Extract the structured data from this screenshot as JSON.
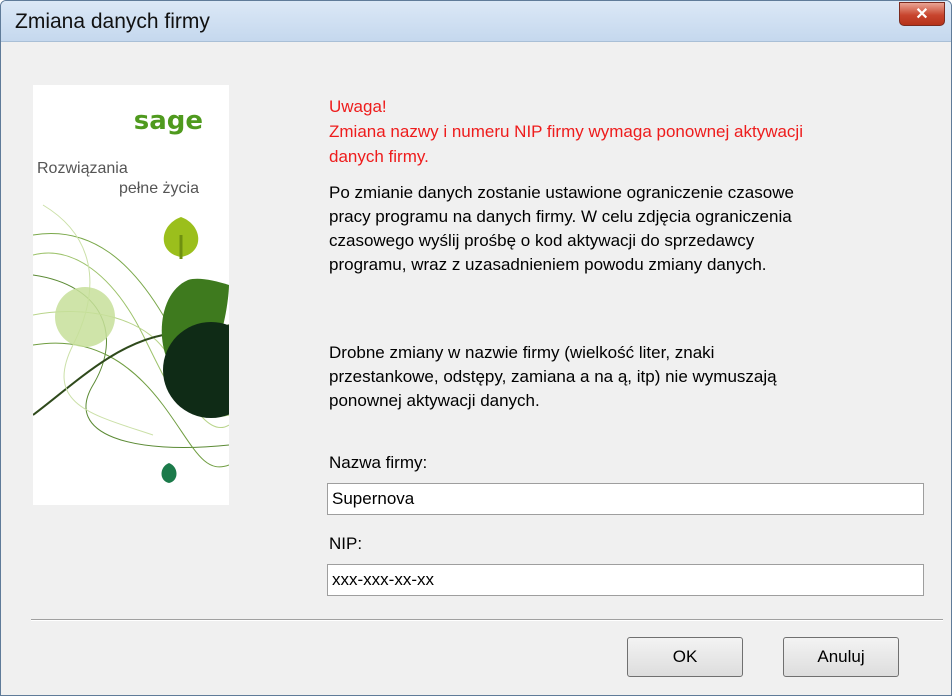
{
  "window": {
    "title": "Zmiana danych firmy",
    "close_label": "✕"
  },
  "banner": {
    "brand": "sage",
    "tagline_line1": "Rozwiązania",
    "tagline_line2": "pełne życia"
  },
  "warning": {
    "line1": "Uwaga!",
    "line2": "Zmiana nazwy i numeru NIP firmy wymaga ponownej aktywacji",
    "line3": "danych firmy."
  },
  "info1": {
    "line1": "Po zmianie danych zostanie ustawione ograniczenie czasowe",
    "line2": "pracy programu na danych firmy. W celu zdjęcia ograniczenia",
    "line3": "czasowego wyślij prośbę o kod aktywacji do sprzedawcy",
    "line4": "programu, wraz z uzasadnieniem powodu zmiany danych."
  },
  "info2": {
    "line1": "Drobne zmiany w nazwie firmy (wielkość liter, znaki",
    "line2": "przestankowe, odstępy, zamiana a na ą, itp) nie wymuszają",
    "line3": "ponownej aktywacji danych."
  },
  "form": {
    "company_label": "Nazwa firmy:",
    "company_value": "Supernova",
    "nip_label": "NIP:",
    "nip_value": "xxx-xxx-xx-xx"
  },
  "buttons": {
    "ok": "OK",
    "cancel": "Anuluj"
  },
  "colors": {
    "warning": "#ee1c1c",
    "brand_green": "#5c9c2c",
    "titlebar": "#c5d8ee"
  }
}
